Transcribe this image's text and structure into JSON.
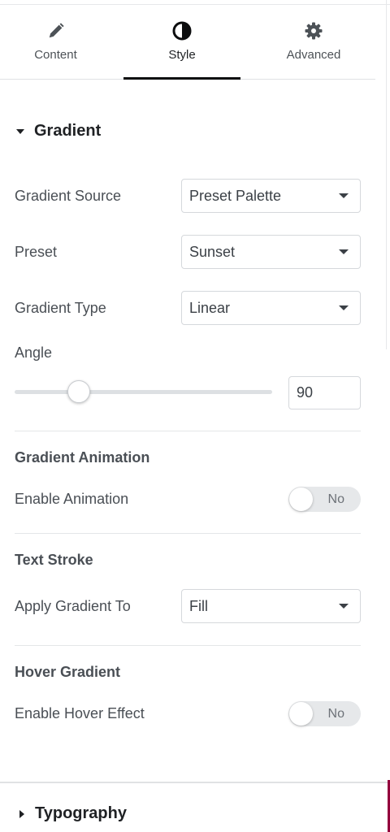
{
  "tabs": [
    {
      "label": "Content",
      "icon": "pencil-icon",
      "active": false
    },
    {
      "label": "Style",
      "icon": "half-circle-icon",
      "active": true
    },
    {
      "label": "Advanced",
      "icon": "gear-icon",
      "active": false
    }
  ],
  "gradient_section": {
    "title": "Gradient",
    "source": {
      "label": "Gradient Source",
      "value": "Preset Palette"
    },
    "preset": {
      "label": "Preset",
      "value": "Sunset"
    },
    "type": {
      "label": "Gradient Type",
      "value": "Linear"
    },
    "angle": {
      "label": "Angle",
      "value": "90",
      "slider_fraction": 0.25
    }
  },
  "animation": {
    "heading": "Gradient Animation",
    "enable_label": "Enable Animation",
    "toggle_text": "No"
  },
  "text_stroke": {
    "heading": "Text Stroke",
    "apply_label": "Apply Gradient To",
    "apply_value": "Fill"
  },
  "hover": {
    "heading": "Hover Gradient",
    "enable_label": "Enable Hover Effect",
    "toggle_text": "No"
  },
  "footer_section": {
    "title": "Typography"
  },
  "colors": {
    "accent": "#93003c",
    "active_tab_underline": "#0c0d0e"
  }
}
